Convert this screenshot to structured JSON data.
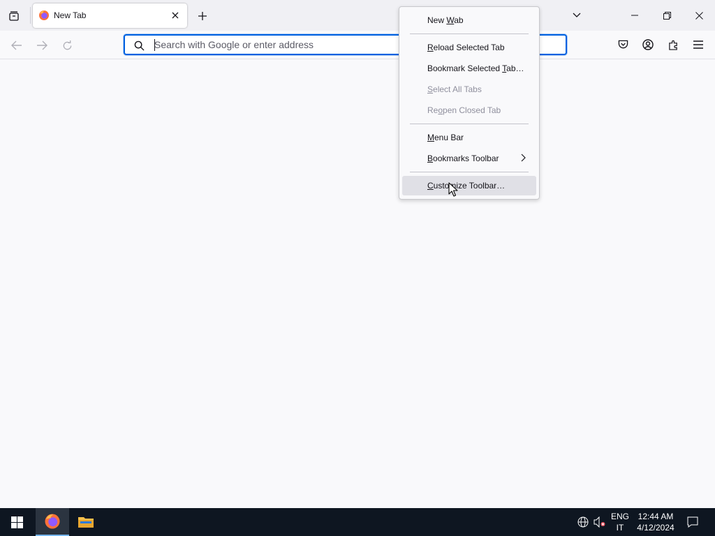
{
  "browser": {
    "tab": {
      "title": "New Tab",
      "favicon": "firefox-icon"
    },
    "tab_strip_icons": [
      "tab-overview-icon",
      "new-tab-plus-icon",
      "list-all-tabs-chevron-icon"
    ],
    "window_controls": [
      "minimize-icon",
      "restore-icon",
      "close-icon"
    ],
    "nav_icons": [
      "back-arrow-icon",
      "forward-arrow-icon",
      "reload-icon"
    ],
    "urlbar": {
      "placeholder": "Search with Google or enter address",
      "value": ""
    },
    "toolbar_icons": [
      "pocket-icon",
      "account-icon",
      "extensions-icon",
      "hamburger-menu-icon"
    ]
  },
  "context_menu": {
    "items": [
      {
        "label_pre": "New ",
        "label_key": "W",
        "label_post": "ab",
        "enabled": true
      },
      {
        "label_pre": "",
        "label_key": "R",
        "label_post": "eload Selected Tab",
        "enabled": true
      },
      {
        "label_pre": "Bookmark Selected ",
        "label_key": "T",
        "label_post": "ab…",
        "enabled": true
      },
      {
        "label_pre": "",
        "label_key": "S",
        "label_post": "elect All Tabs",
        "enabled": false
      },
      {
        "label_pre": "Re",
        "label_key": "o",
        "label_post": "pen Closed Tab",
        "enabled": false
      },
      {
        "label_pre": "",
        "label_key": "M",
        "label_post": "enu Bar",
        "enabled": true
      },
      {
        "label_pre": "",
        "label_key": "B",
        "label_post": "ookmarks Toolbar",
        "enabled": true,
        "submenu": true
      },
      {
        "label_pre": "",
        "label_key": "C",
        "label_post": "ustomize Toolbar…",
        "enabled": true,
        "hovered": true
      }
    ]
  },
  "taskbar": {
    "apps": [
      "windows-start-icon",
      "firefox-icon",
      "file-explorer-icon"
    ],
    "tray": {
      "language_top": "ENG",
      "language_bottom": "IT",
      "time": "12:44 AM",
      "date": "4/12/2024"
    }
  },
  "colors": {
    "accent": "#0061e0",
    "taskbar": "#0e1621",
    "tabstrip": "#f0f0f4",
    "content": "#f9f9fb"
  }
}
